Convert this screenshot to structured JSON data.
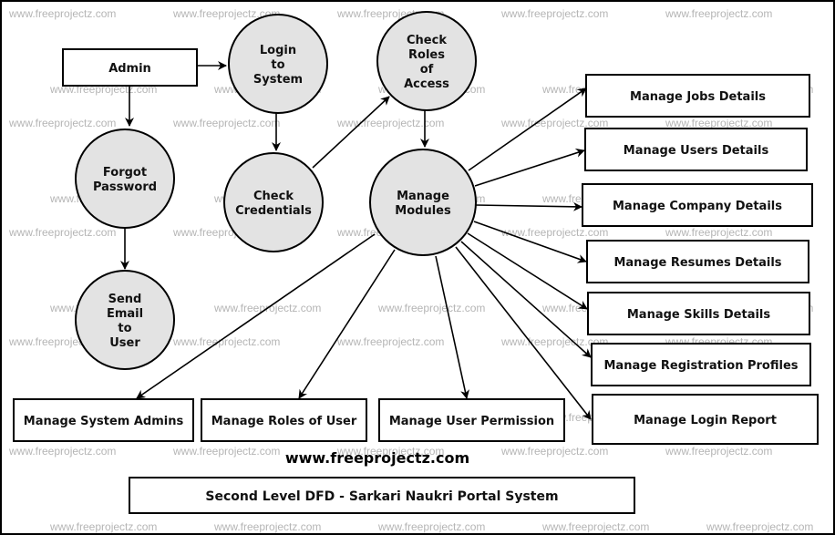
{
  "diagram": {
    "site_label": "www.freeprojectz.com",
    "title": "Second Level DFD - Sarkari Naukri Portal System",
    "watermark": "www.freeprojectz.com",
    "entities": [
      {
        "id": "admin",
        "label": "Admin"
      }
    ],
    "processes": [
      {
        "id": "login",
        "lines": [
          "Login",
          "to",
          "System"
        ]
      },
      {
        "id": "check_roles",
        "lines": [
          "Check",
          "Roles",
          "of",
          "Access"
        ]
      },
      {
        "id": "forgot",
        "lines": [
          "Forgot",
          "Password"
        ]
      },
      {
        "id": "check_cred",
        "lines": [
          "Check",
          "Credentials"
        ]
      },
      {
        "id": "manage_modules",
        "lines": [
          "Manage",
          "Modules"
        ]
      },
      {
        "id": "send_email",
        "lines": [
          "Send",
          "Email",
          "to",
          "User"
        ]
      }
    ],
    "modules": [
      {
        "id": "jobs",
        "label": "Manage Jobs Details"
      },
      {
        "id": "users",
        "label": "Manage Users Details"
      },
      {
        "id": "company",
        "label": "Manage Company Details"
      },
      {
        "id": "resumes",
        "label": "Manage Resumes Details"
      },
      {
        "id": "skills",
        "label": "Manage Skills Details"
      },
      {
        "id": "registration",
        "label": "Manage Registration Profiles"
      },
      {
        "id": "login_report",
        "label": "Manage Login Report"
      },
      {
        "id": "system_admins",
        "label": "Manage System Admins"
      },
      {
        "id": "roles",
        "label": "Manage Roles of User"
      },
      {
        "id": "permission",
        "label": "Manage User Permission"
      }
    ],
    "flows": [
      {
        "from": "admin",
        "to": "login"
      },
      {
        "from": "admin",
        "to": "forgot"
      },
      {
        "from": "login",
        "to": "check_cred"
      },
      {
        "from": "check_cred",
        "to": "check_roles"
      },
      {
        "from": "check_roles",
        "to": "manage_modules"
      },
      {
        "from": "forgot",
        "to": "send_email"
      },
      {
        "from": "manage_modules",
        "to": "jobs"
      },
      {
        "from": "manage_modules",
        "to": "users"
      },
      {
        "from": "manage_modules",
        "to": "company"
      },
      {
        "from": "manage_modules",
        "to": "resumes"
      },
      {
        "from": "manage_modules",
        "to": "skills"
      },
      {
        "from": "manage_modules",
        "to": "registration"
      },
      {
        "from": "manage_modules",
        "to": "login_report"
      },
      {
        "from": "manage_modules",
        "to": "system_admins"
      },
      {
        "from": "manage_modules",
        "to": "roles"
      },
      {
        "from": "manage_modules",
        "to": "permission"
      }
    ]
  }
}
